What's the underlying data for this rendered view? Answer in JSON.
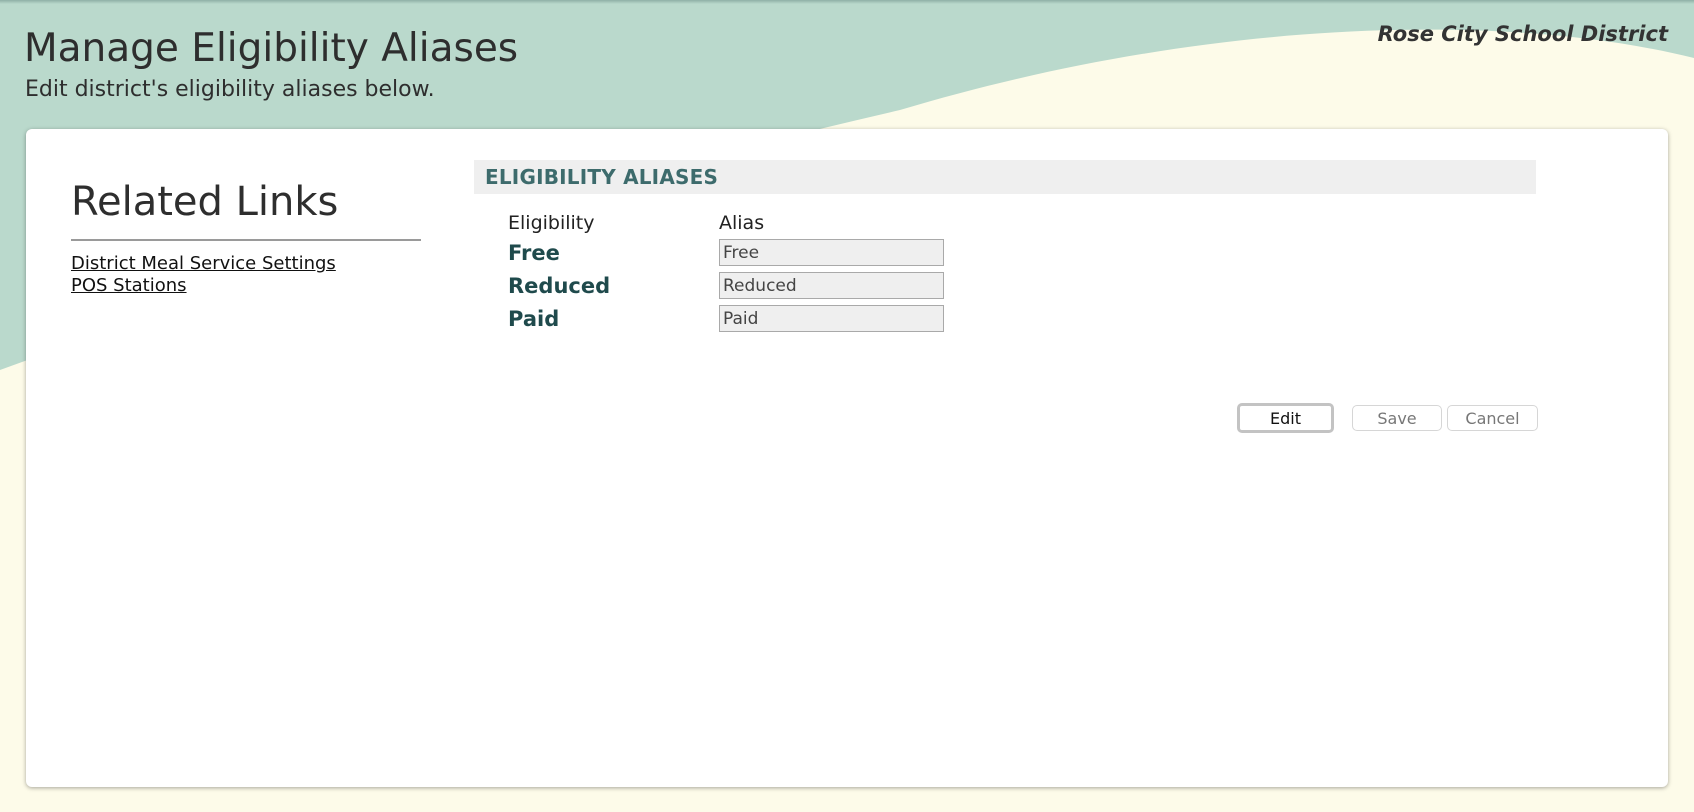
{
  "header": {
    "title": "Manage Eligibility Aliases",
    "subtitle": "Edit district's eligibility aliases below.",
    "district_name": "Rose City School District"
  },
  "sidebar": {
    "title": "Related Links",
    "links": [
      {
        "label": "District Meal Service Settings"
      },
      {
        "label": "POS Stations"
      }
    ]
  },
  "aliases_section": {
    "header": "ELIGIBILITY ALIASES",
    "columns": {
      "eligibility": "Eligibility",
      "alias": "Alias"
    },
    "rows": [
      {
        "eligibility": "Free",
        "alias": "Free"
      },
      {
        "eligibility": "Reduced",
        "alias": "Reduced"
      },
      {
        "eligibility": "Paid",
        "alias": "Paid"
      }
    ]
  },
  "buttons": {
    "edit": "Edit",
    "save": "Save",
    "cancel": "Cancel"
  },
  "colors": {
    "header_teal": "#bad9cc",
    "background_cream": "#fdfbe9",
    "section_header_text": "#3d6b6c",
    "row_label_text": "#1f4a4c"
  }
}
